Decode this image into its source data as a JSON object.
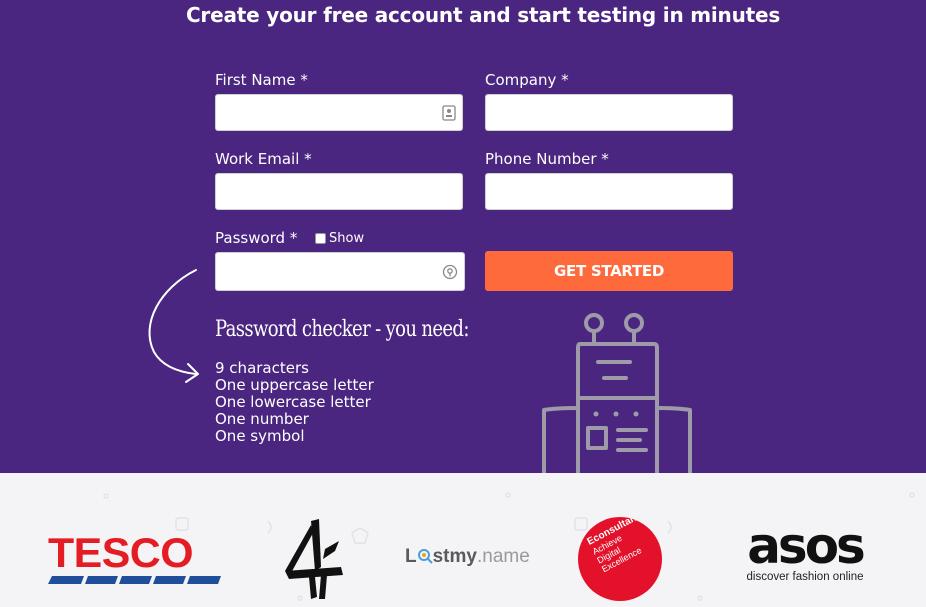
{
  "headline": "Create your free account and start testing in minutes",
  "form": {
    "first_name_label": "First Name *",
    "company_label": "Company *",
    "work_email_label": "Work Email *",
    "phone_label": "Phone Number *",
    "password_label": "Password *",
    "show_label": "Show",
    "cta_label": "GET STARTED"
  },
  "checker": {
    "title": "Password checker - you need:",
    "requirements": [
      "9 characters",
      "One uppercase letter",
      "One lowercase letter",
      "One number",
      "One symbol"
    ]
  },
  "logos": {
    "tesco": "TESCO",
    "lostmy_a": "L",
    "lostmy_b": "stmy",
    "lostmy_c": ".name",
    "econsultancy": [
      "Econsultancy",
      "Achieve",
      "Digital",
      "Excellence"
    ],
    "asos": "asos",
    "asos_tagline": "discover fashion online"
  },
  "colors": {
    "hero_bg": "#4a2680",
    "cta": "#ff6a3d",
    "tesco_red": "#e41c23",
    "tesco_blue": "#1f4e9b",
    "econ_red": "#e4112b"
  }
}
